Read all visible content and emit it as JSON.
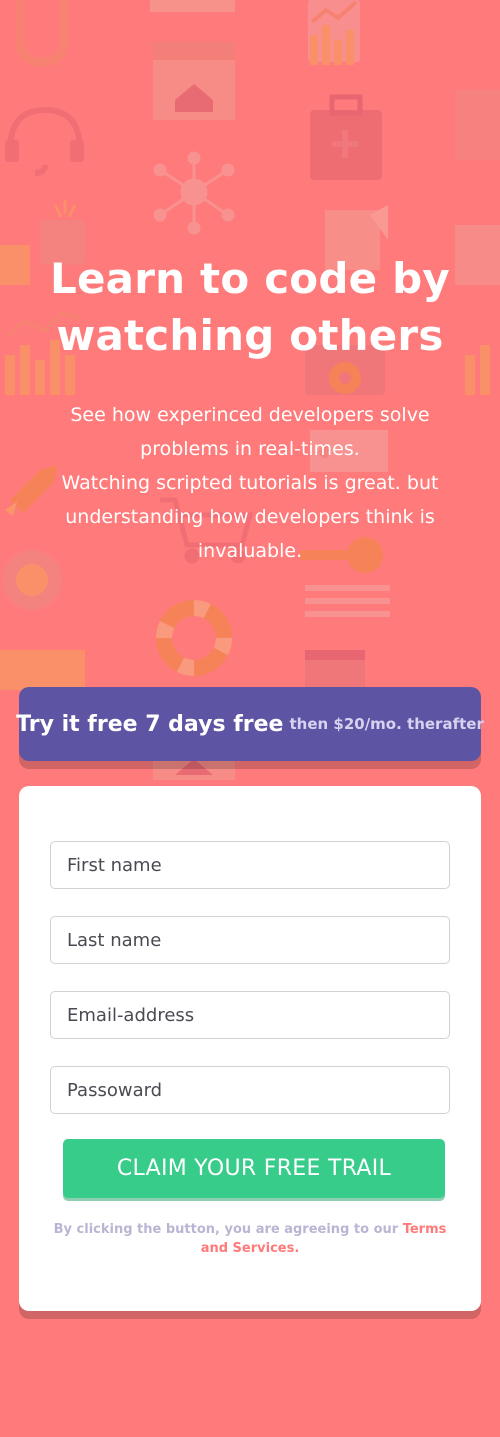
{
  "hero": {
    "title": "Learn to code by watching others",
    "description": [
      "See how experinced developers solve problems in real-times.",
      "Watching scripted tutorials is great. but understanding how developers think is invaluable."
    ]
  },
  "promo": {
    "main_text": "Try it free 7 days free",
    "sub_text": "then $20/mo. therafter"
  },
  "form": {
    "first_name_placeholder": "First name",
    "last_name_placeholder": "Last name",
    "email_placeholder": "Email-address",
    "password_placeholder": "Passoward",
    "submit_label": "CLAIM YOUR FREE TRAIL",
    "terms_text": "By clicking the button, you are agreeing to our",
    "terms_link": "Terms and Services."
  },
  "colors": {
    "background": "#ff7a7a",
    "promo": "#5e54a4",
    "cta": "#38cc8b",
    "card": "#ffffff"
  }
}
